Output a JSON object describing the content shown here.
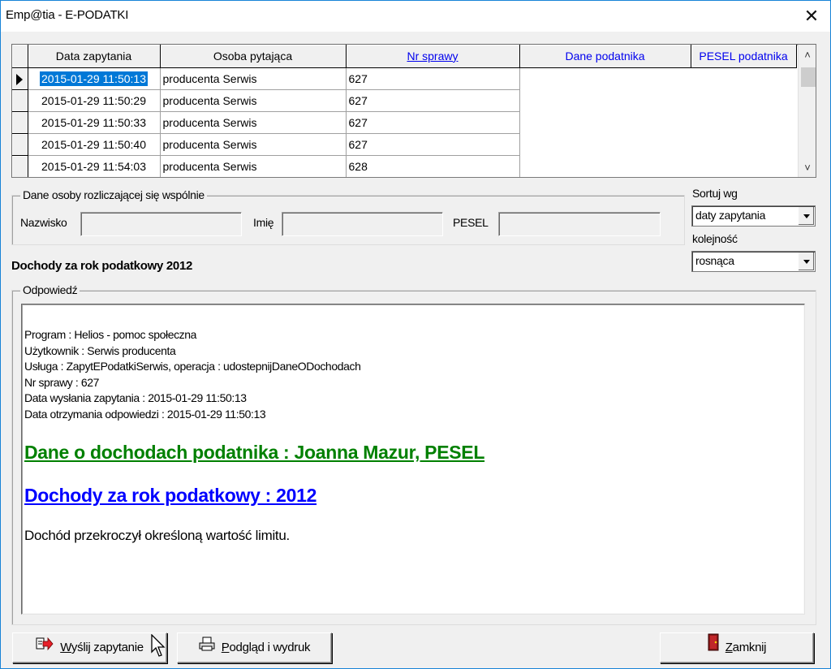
{
  "window": {
    "title": "Emp@tia - E-PODATKI",
    "close_glyph": "✕"
  },
  "grid": {
    "columns": [
      "Data zapytania",
      "Osoba pytająca",
      "Nr sprawy",
      "Dane podatnika",
      "PESEL podatnika"
    ],
    "rows": [
      {
        "date": "2015-01-29 11:50:13",
        "person": "producenta Serwis",
        "case": "627",
        "selected": true
      },
      {
        "date": "2015-01-29 11:50:29",
        "person": "producenta Serwis",
        "case": "627"
      },
      {
        "date": "2015-01-29 11:50:33",
        "person": "producenta Serwis",
        "case": "627"
      },
      {
        "date": "2015-01-29 11:50:40",
        "person": "producenta Serwis",
        "case": "627"
      },
      {
        "date": "2015-01-29 11:54:03",
        "person": "producenta Serwis",
        "case": "628"
      }
    ]
  },
  "joint": {
    "legend": "Dane osoby rozliczającej się wspólnie",
    "surname_label": "Nazwisko",
    "name_label": "Imię",
    "pesel_label": "PESEL"
  },
  "sort": {
    "sort_label": "Sortuj wg",
    "sort_value": "daty zapytania",
    "order_label": "kolejność",
    "order_value": "rosnąca"
  },
  "income_heading": "Dochody za rok podatkowy 2012",
  "answer": {
    "legend": "Odpowiedź",
    "lines": [
      "Program : Helios - pomoc społeczna",
      "Użytkownik : Serwis producenta",
      "Usługa : ZapytEPodatkiSerwis, operacja : udostepnijDaneODochodach",
      "Nr sprawy : 627",
      "Data wysłania zapytania : 2015-01-29 11:50:13",
      "Data otrzymania odpowiedzi : 2015-01-29 11:50:13"
    ],
    "heading_taxpayer": "Dane o dochodach podatnika : Joanna Mazur, PESEL",
    "heading_year": "Dochody za rok podatkowy : 2012",
    "message": "Dochód przekroczył określoną wartość limitu."
  },
  "buttons": {
    "send_accel": "W",
    "send_rest": "yślij zapytanie",
    "preview_accel": "P",
    "preview_rest": "odgląd i wydruk",
    "close_accel": "Z",
    "close_rest": "amknij"
  },
  "colors": {
    "selection": "#0078d7",
    "green_heading": "#008000",
    "blue_heading": "#0000ff",
    "link_header": "#0000ee"
  }
}
